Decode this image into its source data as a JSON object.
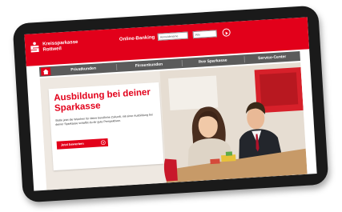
{
  "header": {
    "brand_line1": "Kreissparkasse",
    "brand_line2": "Rottweil",
    "online_banking_label": "Online-Banking",
    "username_placeholder": "Anmeldename",
    "pin_placeholder": "PIN"
  },
  "nav": {
    "items": [
      {
        "label": "Privatkunden"
      },
      {
        "label": "Firmenkunden"
      },
      {
        "label": "Ihre Sparkasse"
      },
      {
        "label": "Service-Center"
      }
    ]
  },
  "hero": {
    "title": "Ausbildung bei deiner Sparkasse",
    "text": "Stelle jetzt die Weichen für deine berufliche Zukunft, mit einer Ausbildung bei deiner Sparkasse schaffst du dir gute Perspektiven.",
    "cta_label": "Jetzt bewerben"
  },
  "colors": {
    "brand_red": "#e2001a",
    "nav_gray": "#5b5b5b"
  },
  "icons": [
    "sparkasse-logo-icon",
    "home-icon",
    "arrow-right-icon"
  ]
}
